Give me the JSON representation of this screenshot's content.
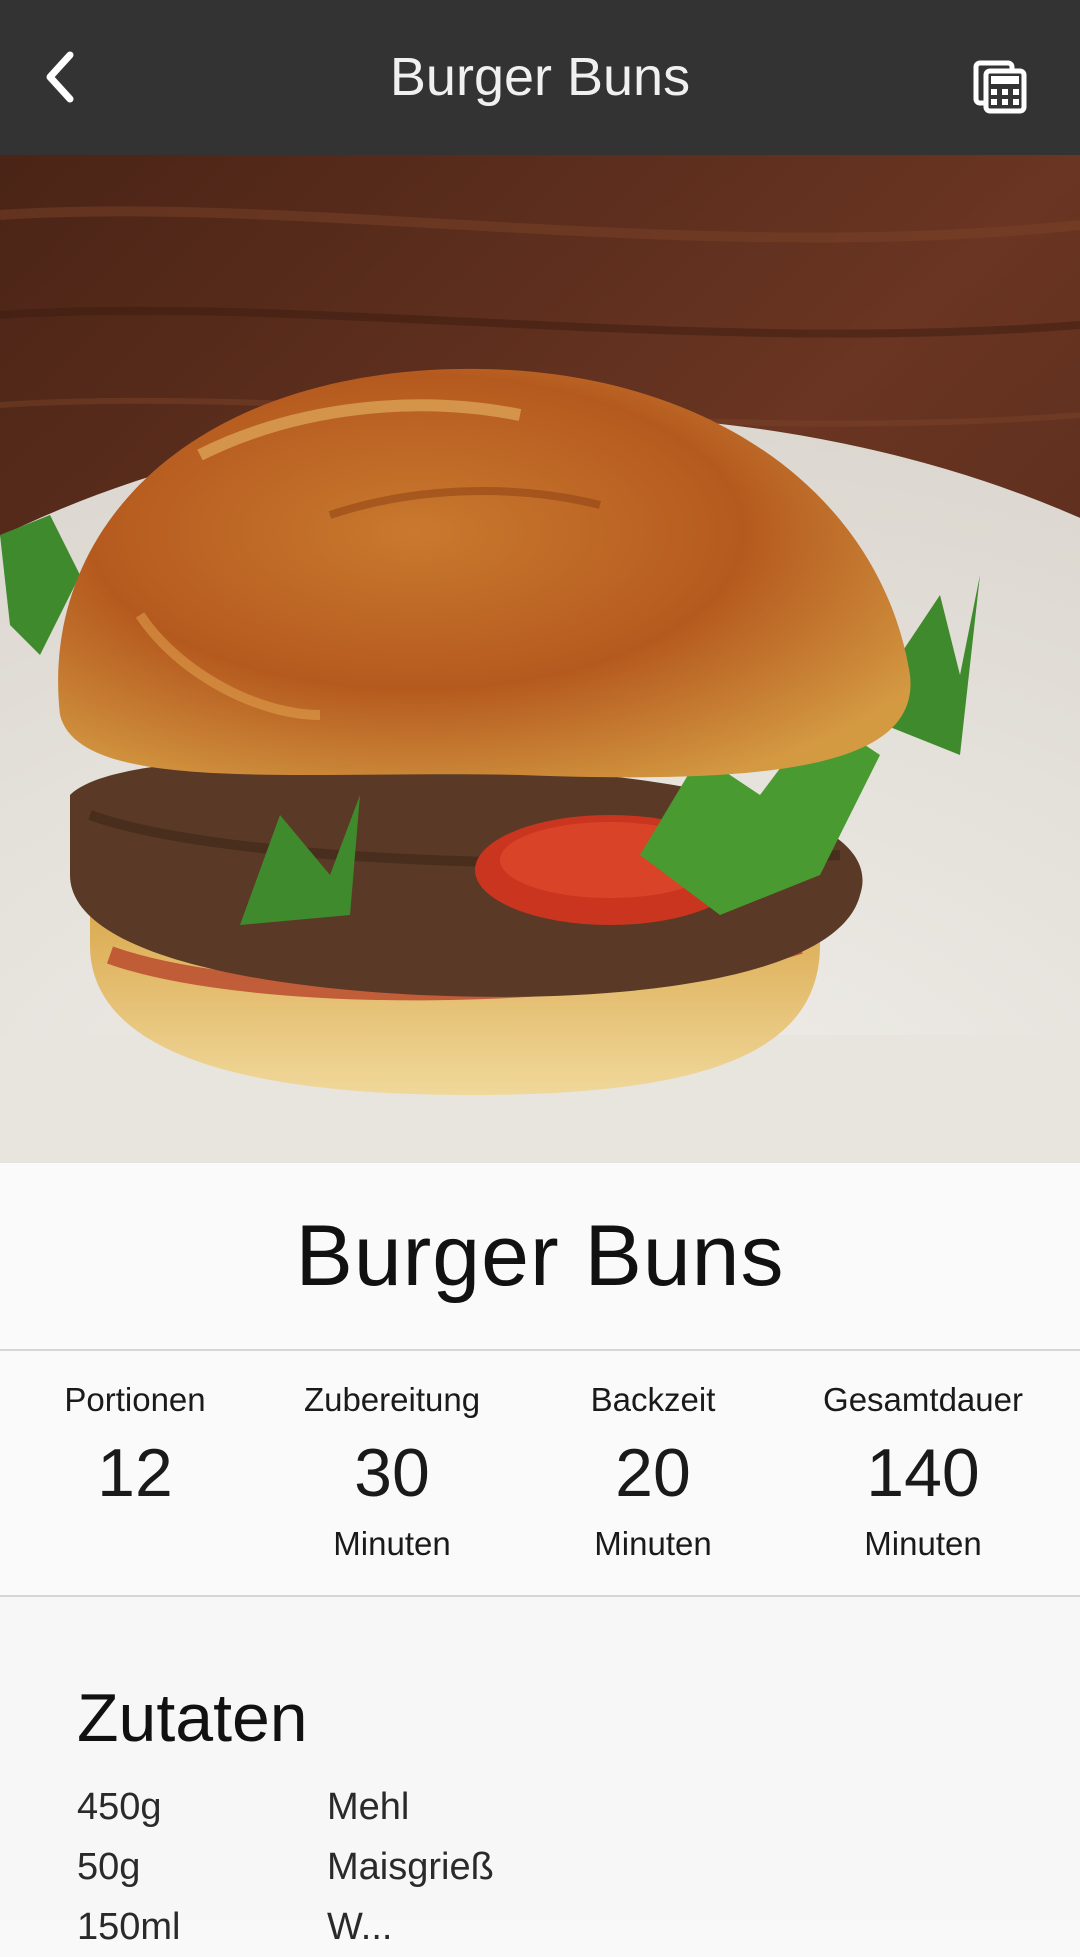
{
  "appbar": {
    "title": "Burger Buns",
    "back_icon": "chevron-left-icon",
    "calculator_icon": "calculator-icon",
    "background": "#333333"
  },
  "hero": {
    "image_alt": "Burger mit Burger Bun auf einem Teller"
  },
  "recipe": {
    "title": "Burger Buns"
  },
  "stats": [
    {
      "label": "Portionen",
      "value": "12",
      "unit": ""
    },
    {
      "label": "Zubereitung",
      "value": "30",
      "unit": "Minuten"
    },
    {
      "label": "Backzeit",
      "value": "20",
      "unit": "Minuten"
    },
    {
      "label": "Gesamtdauer",
      "value": "140",
      "unit": "Minuten"
    }
  ],
  "ingredients": {
    "heading": "Zutaten",
    "items": [
      {
        "amount": "450g",
        "name": "Mehl"
      },
      {
        "amount": "50g",
        "name": "Maisgrieß"
      },
      {
        "amount": "150ml",
        "name": "W..."
      }
    ]
  }
}
